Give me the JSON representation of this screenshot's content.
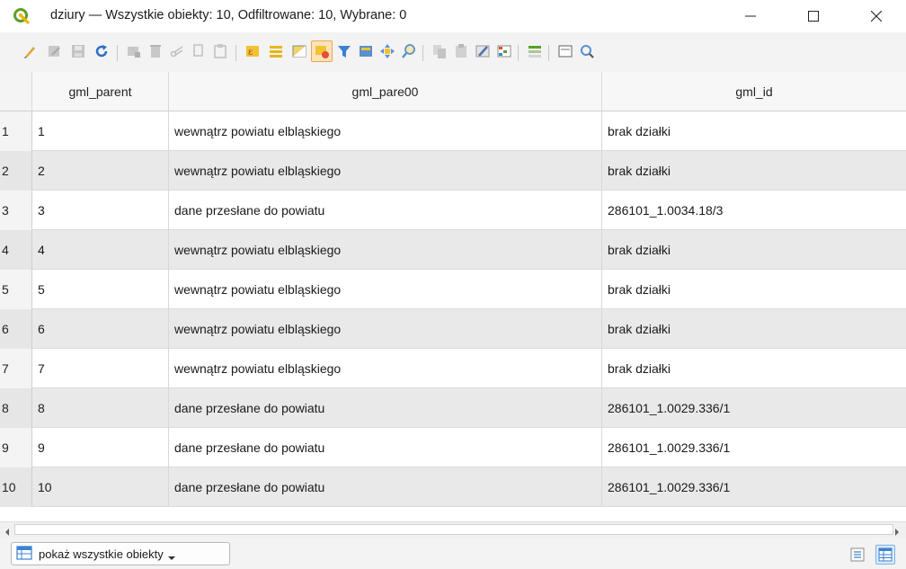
{
  "window": {
    "title": "dziury — Wszystkie obiekty: 10, Odfiltrowane: 10, Wybrane: 0",
    "controls": [
      "minimize",
      "maximize",
      "close"
    ]
  },
  "toolbar": {
    "icons": [
      "toggle-editing-icon",
      "multi-edit-icon",
      "save-edits-icon",
      "reload-icon",
      "add-feature-icon",
      "delete-feature-icon",
      "cut-icon",
      "copy-icon",
      "paste-icon",
      "select-by-expression-icon",
      "select-all-icon",
      "invert-selection-icon",
      "deselect-all-icon",
      "filter-icon",
      "move-selection-to-top-icon",
      "pan-to-selected-icon",
      "zoom-to-selected-icon",
      "copy-rows-icon",
      "paste-rows-icon",
      "field-calculator-icon",
      "conditional-formatting-icon",
      "organize-columns-icon",
      "actions-icon",
      "dock-icon"
    ]
  },
  "table": {
    "columns": [
      "gml_parent",
      "gml_pare00",
      "gml_id"
    ],
    "rows": [
      {
        "num": "1",
        "gml_parent": "1",
        "gml_pare00": "wewnątrz powiatu elbląskiego",
        "gml_id": "brak  działki"
      },
      {
        "num": "2",
        "gml_parent": "2",
        "gml_pare00": "wewnątrz powiatu elbląskiego",
        "gml_id": "brak  działki"
      },
      {
        "num": "3",
        "gml_parent": "3",
        "gml_pare00": "dane przesłane do powiatu",
        "gml_id": "286101_1.0034.18/3"
      },
      {
        "num": "4",
        "gml_parent": "4",
        "gml_pare00": "wewnątrz powiatu elbląskiego",
        "gml_id": "brak  działki"
      },
      {
        "num": "5",
        "gml_parent": "5",
        "gml_pare00": "wewnątrz powiatu elbląskiego",
        "gml_id": "brak  działki"
      },
      {
        "num": "6",
        "gml_parent": "6",
        "gml_pare00": "wewnątrz powiatu elbląskiego",
        "gml_id": "brak  działki"
      },
      {
        "num": "7",
        "gml_parent": "7",
        "gml_pare00": "wewnątrz powiatu elbląskiego",
        "gml_id": "brak  działki"
      },
      {
        "num": "8",
        "gml_parent": "8",
        "gml_pare00": "dane przesłane do powiatu",
        "gml_id": "286101_1.0029.336/1"
      },
      {
        "num": "9",
        "gml_parent": "9",
        "gml_pare00": "dane przesłane do powiatu",
        "gml_id": "286101_1.0029.336/1"
      },
      {
        "num": "10",
        "gml_parent": "10",
        "gml_pare00": "dane przesłane do powiatu",
        "gml_id": "286101_1.0029.336/1"
      }
    ]
  },
  "bottom": {
    "filter_label": "pokaż wszystkie obiekty"
  },
  "colors": {
    "accent": "#5aa02c",
    "row_alt": "#e9e9e9",
    "header": "#f7f7f7"
  }
}
